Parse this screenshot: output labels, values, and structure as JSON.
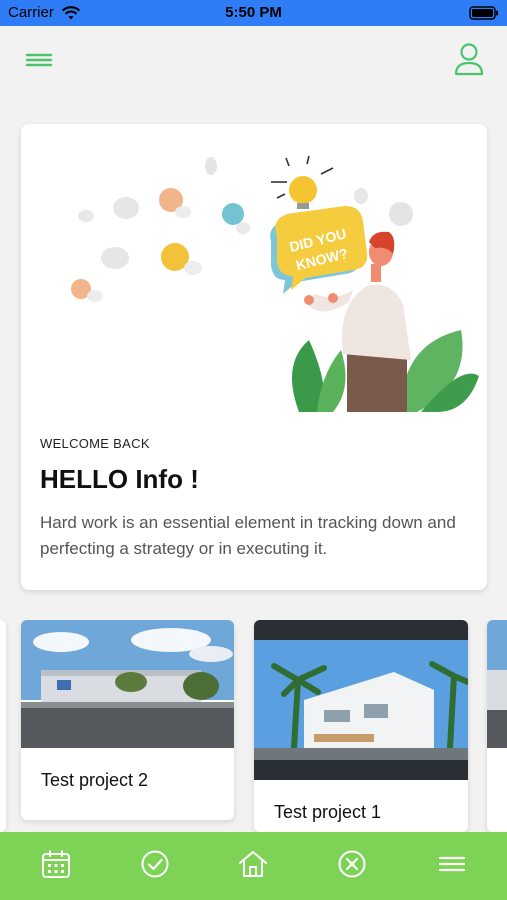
{
  "status_bar": {
    "carrier": "Carrier",
    "time": "5:50 PM"
  },
  "top_nav": {
    "menu_icon": "hamburger-menu-icon",
    "profile_icon": "user-profile-icon"
  },
  "welcome": {
    "illustration_text": "DID YOU KNOW?",
    "label": "WELCOME BACK",
    "title": "HELLO Info !",
    "body": "Hard work is an essential element in tracking down and perfecting a strategy or in executing it."
  },
  "projects": [
    {
      "name": "Test project 2"
    },
    {
      "name": "Test project 1"
    }
  ],
  "tab_bar": {
    "items": [
      {
        "icon": "calendar-icon"
      },
      {
        "icon": "check-circle-icon"
      },
      {
        "icon": "home-icon"
      },
      {
        "icon": "cancel-circle-icon"
      },
      {
        "icon": "hamburger-menu-icon"
      }
    ]
  },
  "colors": {
    "accent": "#4cc46e",
    "tab_bar": "#7ed356",
    "status_bar": "#2f7df6"
  }
}
